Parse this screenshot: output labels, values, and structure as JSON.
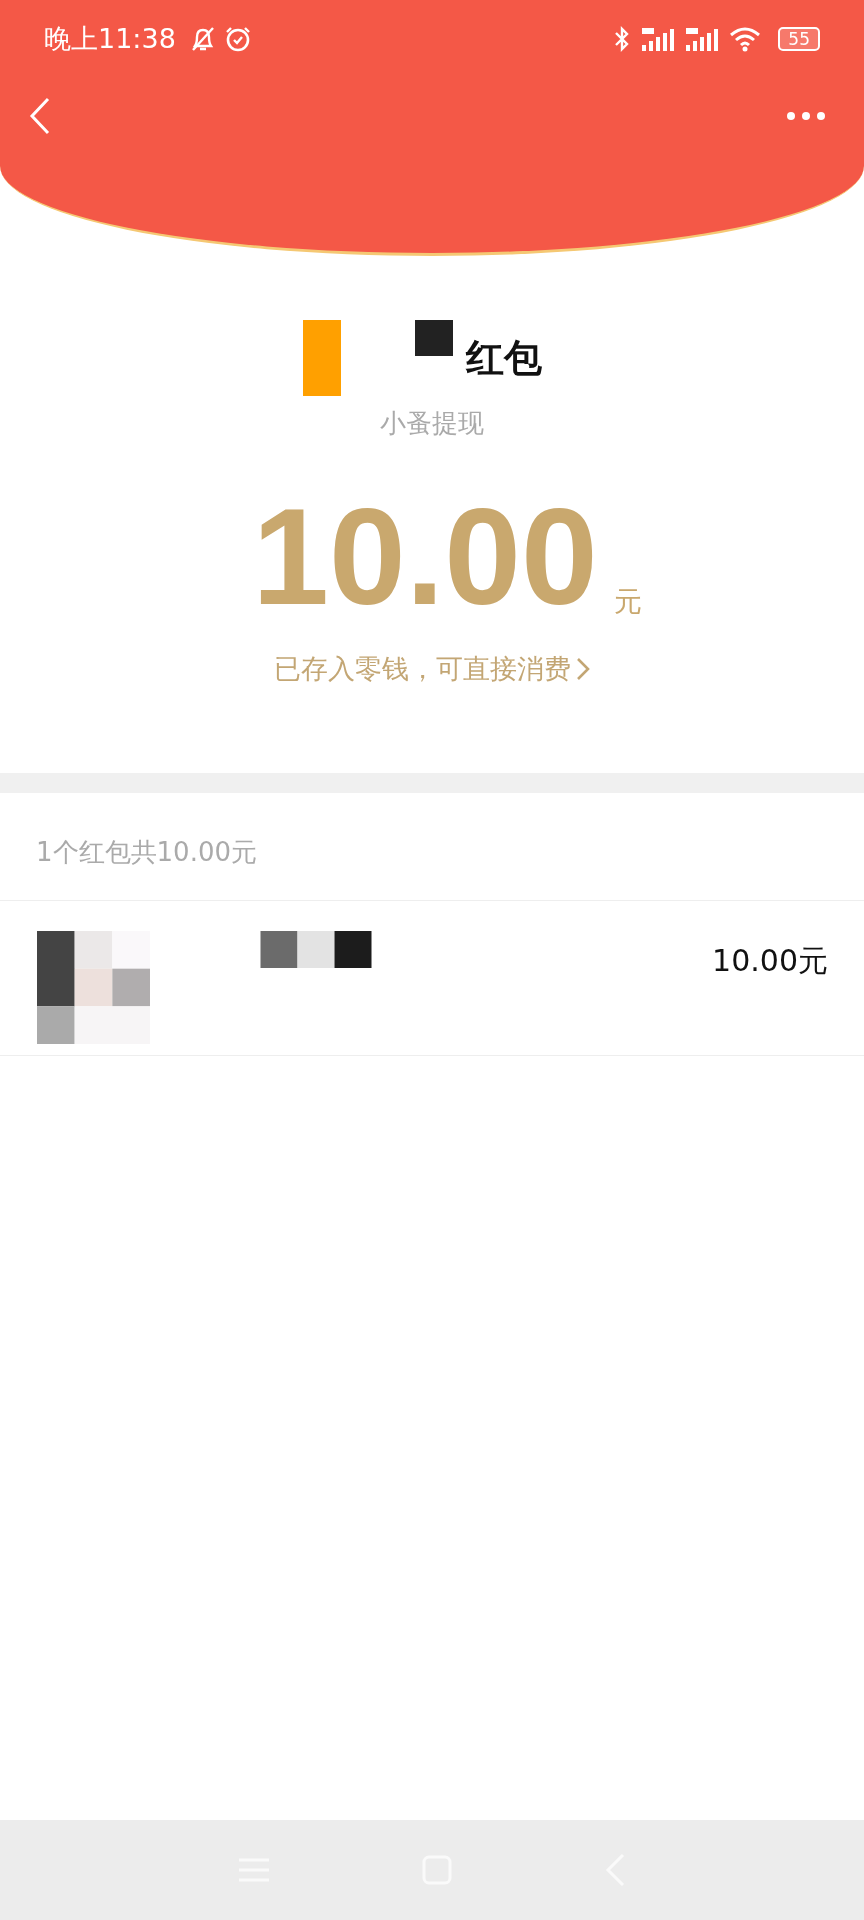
{
  "status_bar": {
    "time": "晚上11:38",
    "battery": "55"
  },
  "packet": {
    "title": "红包",
    "subtitle": "小蚤提现",
    "amount": "10.00",
    "unit": "元",
    "note": "已存入零钱，可直接消费"
  },
  "summary": "1个红包共10.00元",
  "records": [
    {
      "amount": "10.00元"
    }
  ]
}
